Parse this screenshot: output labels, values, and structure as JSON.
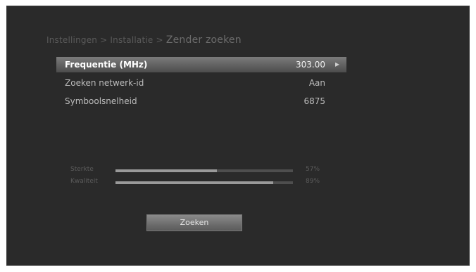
{
  "breadcrumb": {
    "items": [
      "Instellingen",
      "Installatie"
    ],
    "separator": ">",
    "current": "Zender zoeken"
  },
  "settings": [
    {
      "label": "Frequentie (MHz)",
      "value": "303.00",
      "selected": true
    },
    {
      "label": "Zoeken netwerk-id",
      "value": "Aan",
      "selected": false
    },
    {
      "label": "Symboolsnelheid",
      "value": "6875",
      "selected": false
    }
  ],
  "signal": {
    "strength": {
      "label": "Sterkte",
      "percent": 57,
      "text": "57%"
    },
    "quality": {
      "label": "Kwaliteit",
      "percent": 89,
      "text": "89%"
    }
  },
  "actions": {
    "search_label": "Zoeken"
  },
  "colors": {
    "background": "#2a2a2a",
    "selected_row": "#6a6a6a",
    "bar_fill": "#9a9a9a"
  },
  "icons": {
    "selected_value_arrow": "chevron-right-icon"
  }
}
